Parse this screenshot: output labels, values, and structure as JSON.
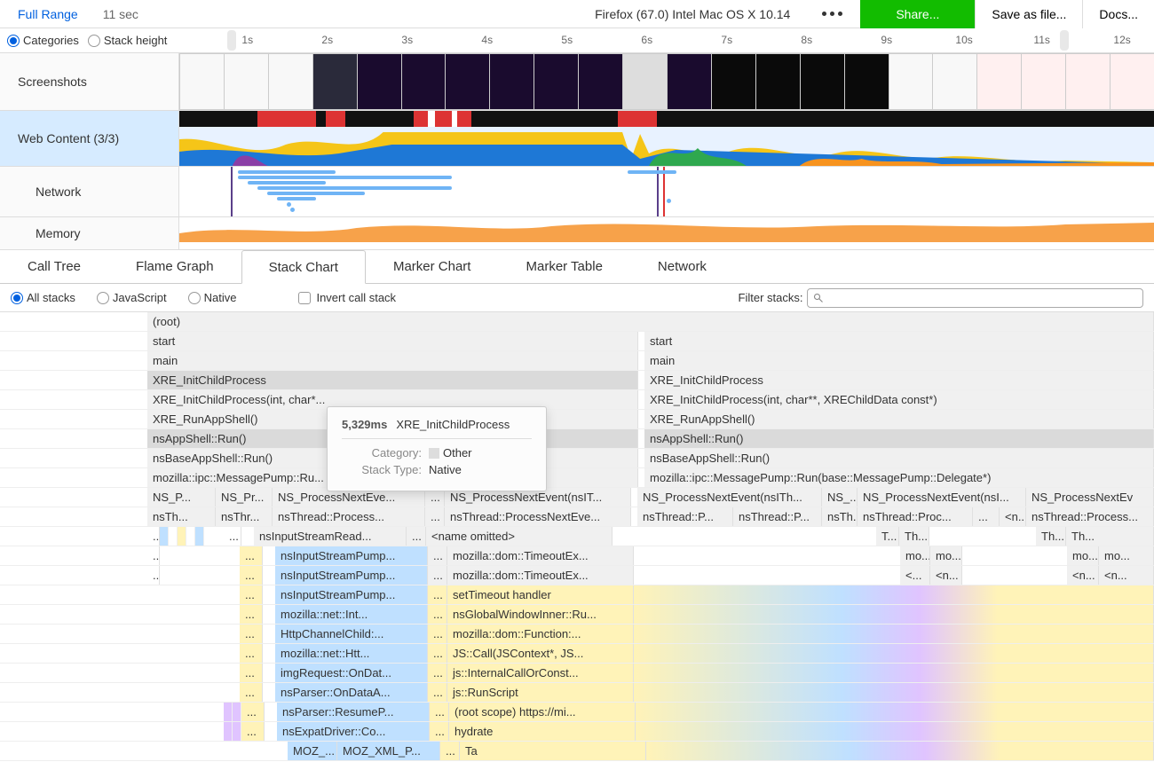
{
  "topbar": {
    "full_range": "Full Range",
    "duration": "11 sec",
    "browser": "Firefox (67.0) Intel Mac OS X 10.14",
    "share": "Share...",
    "save": "Save as file...",
    "docs": "Docs..."
  },
  "view_mode": {
    "categories": "Categories",
    "stack_height": "Stack height"
  },
  "ruler_ticks": [
    "1s",
    "2s",
    "3s",
    "4s",
    "5s",
    "6s",
    "7s",
    "8s",
    "9s",
    "10s",
    "11s",
    "12s"
  ],
  "tracks": {
    "screenshots": "Screenshots",
    "web_content": "Web Content (3/3)",
    "network": "Network",
    "memory": "Memory"
  },
  "tabs": {
    "call_tree": "Call Tree",
    "flame_graph": "Flame Graph",
    "stack_chart": "Stack Chart",
    "marker_chart": "Marker Chart",
    "marker_table": "Marker Table",
    "network": "Network"
  },
  "filters": {
    "all_stacks": "All stacks",
    "javascript": "JavaScript",
    "native": "Native",
    "invert": "Invert call stack",
    "filter_label": "Filter stacks:"
  },
  "tooltip": {
    "ms": "5,329ms",
    "fn": "XRE_InitChildProcess",
    "category_label": "Category:",
    "category_value": "Other",
    "stacktype_label": "Stack Type:",
    "stacktype_value": "Native"
  },
  "stack": {
    "root": "(root)",
    "start": "start",
    "main": "main",
    "xre_init": "XRE_InitChildProcess",
    "xre_init_full": "XRE_InitChildProcess(int, char*...",
    "xre_init_full2": "XRE_InitChildProcess(int, char**, XREChildData const*)",
    "xre_run": "XRE_RunAppShell()",
    "appshell": "nsAppShell::Run()",
    "baseapp": "nsBaseAppShell::Run()",
    "msgpump": "mozilla::ipc::MessagePump::Ru...",
    "msgpump2": "mozilla::ipc::MessagePump::Run(base::MessagePump::Delegate*)",
    "ns_p": "NS_P...",
    "ns_pr": "NS_Pr...",
    "ns_proc": "NS_ProcessNextEve...",
    "ns_proct": "NS_ProcessNextEvent(nsIT...",
    "ns_procth": "NS_ProcessNextEvent(nsITh...",
    "ns_dots": "NS_...",
    "ns_procl": "NS_ProcessNextEvent(nsI...",
    "ns_procev": "NS_ProcessNextEv",
    "nsth": "nsTh...",
    "nsthr": "nsThr...",
    "nsthread": "nsThread::Process...",
    "nsthreade": "nsThread::ProcessNextEve...",
    "nsthp": "nsThread::P...",
    "nsthproc": "nsThread::Proc...",
    "th": "Th...",
    "t": "T...",
    "ell": "...",
    "mo": "mo...",
    "lt": "<...",
    "n": "<n...",
    "instream": "nsInputStreamRead...",
    "name_om": "<name omitted>",
    "inpump": "nsInputStreamPump...",
    "timeout": "mozilla::dom::TimeoutEx...",
    "sethandler": "setTimeout handler",
    "netint": "mozilla::net::Int...",
    "global": "nsGlobalWindowInner::Ru...",
    "httpch": "HttpChannelChild:...",
    "domfn": "mozilla::dom::Function:...",
    "nethtt": "mozilla::net::Htt...",
    "jscall": "JS::Call(JSContext*, JS...",
    "imgreq": "imgRequest::OnDat...",
    "jsint": "js::InternalCallOrConst...",
    "parser": "nsParser::OnDataA...",
    "jsrun": "js::RunScript",
    "parserr": "nsParser::ResumeP...",
    "rootsc": "(root scope) https://mi...",
    "expat": "nsExpatDriver::Co...",
    "hydrate": "hydrate",
    "moz_xml": "MOZ_XML_P...",
    "moz": "MOZ_...",
    "ta": "Ta"
  }
}
